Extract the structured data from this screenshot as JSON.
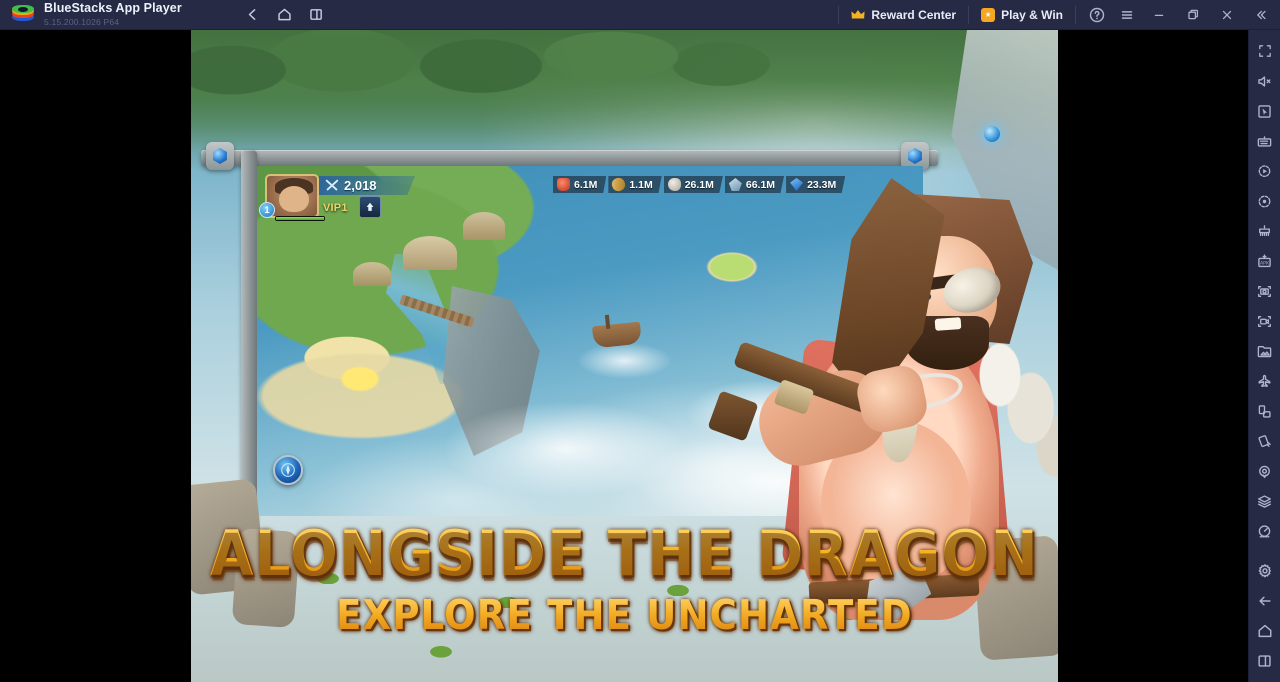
{
  "window": {
    "app_title": "BlueStacks App Player",
    "version": "5.15.200.1026 P64",
    "logo_icon": "bluestacks-logo"
  },
  "titlebar": {
    "nav": [
      {
        "name": "back",
        "icon": "arrow-left-icon"
      },
      {
        "name": "home",
        "icon": "home-icon"
      },
      {
        "name": "recent-apps",
        "icon": "multi-window-icon"
      }
    ],
    "reward_center": {
      "label": "Reward Center",
      "icon": "crown-icon"
    },
    "play_and_win": {
      "label": "Play & Win",
      "icon": "star-badge-icon"
    },
    "help": {
      "icon": "help-circle-icon"
    },
    "menu": {
      "icon": "hamburger-menu-icon"
    },
    "window_controls": [
      {
        "name": "minimize",
        "icon": "minimize-icon"
      },
      {
        "name": "maximize",
        "icon": "restore-window-icon"
      },
      {
        "name": "close",
        "icon": "close-icon"
      },
      {
        "name": "collapse-sidebar",
        "icon": "chevron-double-left-icon"
      }
    ]
  },
  "sidebar": {
    "items": [
      {
        "name": "fullscreen",
        "icon": "fullscreen-icon"
      },
      {
        "name": "mute",
        "icon": "speaker-mute-icon"
      },
      {
        "name": "cursor-control",
        "icon": "cursor-pointer-icon"
      },
      {
        "name": "keyboard-controls",
        "icon": "keyboard-icon"
      },
      {
        "name": "macro-recorder",
        "icon": "macro-play-icon"
      },
      {
        "name": "script",
        "icon": "script-dot-icon"
      },
      {
        "name": "multi-instance",
        "icon": "multi-instance-icon"
      },
      {
        "name": "install-apk",
        "icon": "apk-install-icon"
      },
      {
        "name": "screenshot",
        "icon": "camera-icon"
      },
      {
        "name": "screen-record",
        "icon": "video-record-icon"
      },
      {
        "name": "media-manager",
        "icon": "media-gallery-icon"
      },
      {
        "name": "airplane-mode",
        "icon": "airplane-icon"
      },
      {
        "name": "rotate-screen",
        "icon": "rotate-device-icon"
      },
      {
        "name": "shake",
        "icon": "shake-device-icon"
      },
      {
        "name": "location",
        "icon": "location-pin-icon"
      },
      {
        "name": "layers",
        "icon": "layers-icon"
      },
      {
        "name": "performance",
        "icon": "speedometer-icon"
      },
      {
        "name": "settings",
        "icon": "gear-icon"
      },
      {
        "name": "back",
        "icon": "arrow-left-icon"
      },
      {
        "name": "home",
        "icon": "home-icon"
      },
      {
        "name": "recent-apps",
        "icon": "multi-window-icon"
      }
    ]
  },
  "game": {
    "hud": {
      "player_level": "1",
      "power_value": "2,018",
      "power_icon": "crossed-swords-icon",
      "vip_label": "VIP1",
      "vip_button_icon": "vip-arrow-up-icon",
      "avatar_icon": "player-avatar",
      "resources": [
        {
          "name": "food",
          "icon": "meat-icon",
          "value": "6.1M"
        },
        {
          "name": "wood",
          "icon": "wood-icon",
          "value": "1.1M"
        },
        {
          "name": "stone",
          "icon": "stone-icon",
          "value": "26.1M"
        },
        {
          "name": "ore",
          "icon": "ore-icon",
          "value": "66.1M"
        },
        {
          "name": "gem",
          "icon": "crystal-icon",
          "value": "23.3M"
        }
      ],
      "compass_button_icon": "compass-radar-icon"
    },
    "headline": {
      "line1": "ALONGSIDE THE DRAGON",
      "line2": "EXPLORE THE UNCHARTED"
    }
  },
  "colors": {
    "titlebar_bg": "#272a44",
    "accent_orange": "#f5a623",
    "headline_gold": "#f3ad24",
    "sidebar_bg": "#272a44",
    "letterbox": "#000000"
  }
}
